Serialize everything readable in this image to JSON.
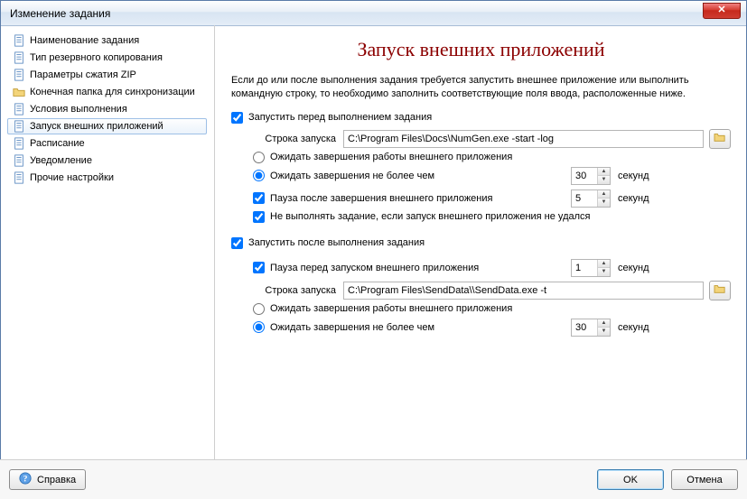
{
  "window": {
    "title": "Изменение задания",
    "close_glyph": "✕"
  },
  "sidebar": {
    "items": [
      {
        "label": "Наименование задания"
      },
      {
        "label": "Тип резервного копирования"
      },
      {
        "label": "Параметры сжатия ZIP"
      },
      {
        "label": "Конечная папка для синхронизации"
      },
      {
        "label": "Условия выполнения"
      },
      {
        "label": "Запуск внешних приложений"
      },
      {
        "label": "Расписание"
      },
      {
        "label": "Уведомление"
      },
      {
        "label": "Прочие настройки"
      }
    ]
  },
  "page": {
    "title": "Запуск внешних приложений",
    "intro": "Если до или после выполнения задания требуется запустить внешнее приложение или выполнить командную строку, то необходимо заполнить соответствующие поля ввода, расположенные ниже."
  },
  "before": {
    "enable_label": "Запустить перед выполнением задания",
    "cmd_label": "Строка запуска",
    "cmd_value": "C:\\Program Files\\Docs\\NumGen.exe -start -log",
    "wait_finish_label": "Ожидать завершения работы внешнего приложения",
    "wait_timed_label": "Ожидать завершения не более чем",
    "wait_seconds": "30",
    "unit": "секунд",
    "pause_after_label": "Пауза после завершения внешнего приложения",
    "pause_after_seconds": "5",
    "fail_abort_label": "Не выполнять задание, если запуск внешнего приложения не удался"
  },
  "after": {
    "enable_label": "Запустить после выполнения задания",
    "pause_before_label": "Пауза перед запуском внешнего приложения",
    "pause_before_seconds": "1",
    "cmd_label": "Строка запуска",
    "cmd_value": "C:\\Program Files\\SendData\\\\SendData.exe -t",
    "wait_finish_label": "Ожидать завершения работы внешнего приложения",
    "wait_timed_label": "Ожидать завершения не более чем",
    "wait_seconds": "30",
    "unit": "секунд"
  },
  "buttons": {
    "help": "Справка",
    "ok": "OK",
    "cancel": "Отмена"
  }
}
